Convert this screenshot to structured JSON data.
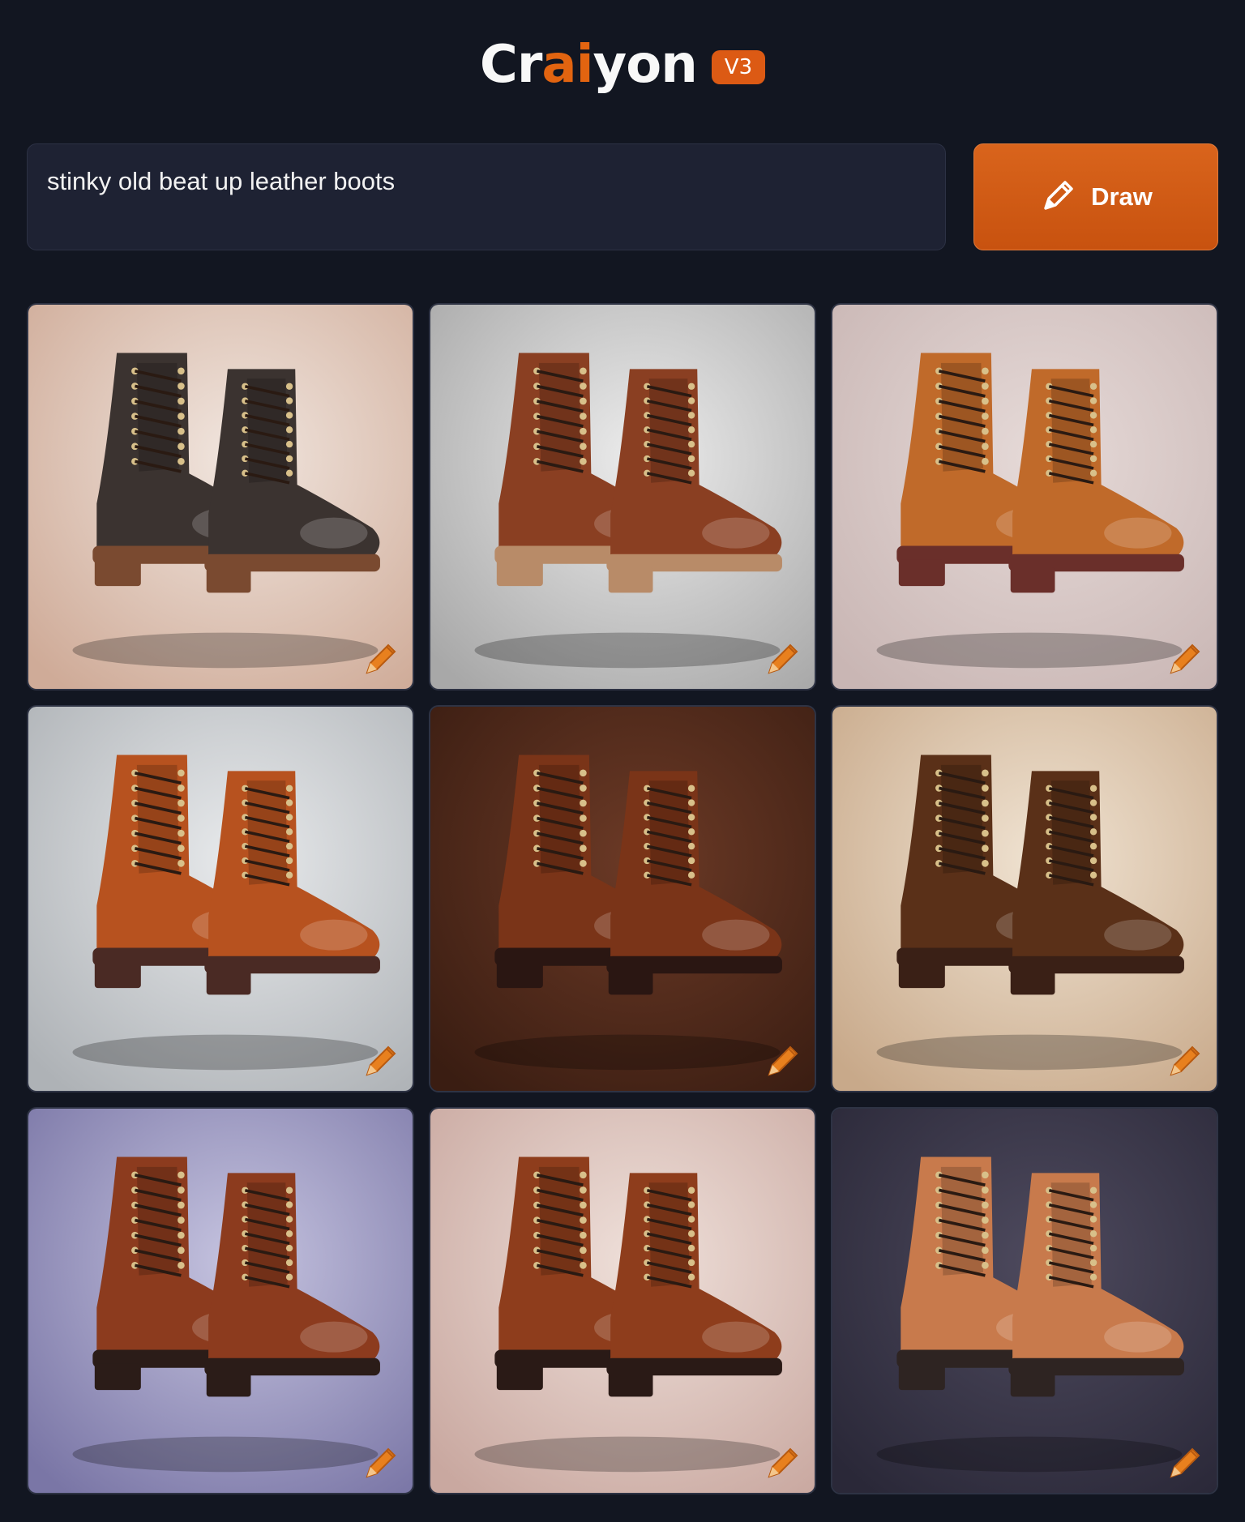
{
  "header": {
    "brand_pre": "Cr",
    "brand_ai": "ai",
    "brand_post": "yon",
    "version": "V3"
  },
  "prompt": {
    "value": "stinky old beat up leather boots"
  },
  "draw_button": {
    "label": "Draw",
    "icon": "pencil-icon"
  },
  "colors": {
    "background": "#121621",
    "accent": "#d9641c",
    "input_bg": "#1e2233"
  },
  "results": [
    {
      "bg": [
        "#cfab98",
        "#f1e6df"
      ],
      "leather": "#3b3330",
      "sole": "#7a4a30"
    },
    {
      "bg": [
        "#a8a8a8",
        "#ececec"
      ],
      "leather": "#8a3f22",
      "sole": "#b88b68"
    },
    {
      "bg": [
        "#c9b6b4",
        "#e6dad8"
      ],
      "leather": "#c06a2a",
      "sole": "#6a2f2a"
    },
    {
      "bg": [
        "#aeb2b6",
        "#e8eaec"
      ],
      "leather": "#b7521f",
      "sole": "#4a2a24"
    },
    {
      "bg": [
        "#3a1d12",
        "#6c3a26"
      ],
      "leather": "#7a3418",
      "sole": "#2a1612"
    },
    {
      "bg": [
        "#c8a98a",
        "#f0e3d2"
      ],
      "leather": "#5a3018",
      "sole": "#3a2016"
    },
    {
      "bg": [
        "#7a76a6",
        "#c6c4e0"
      ],
      "leather": "#8c3b1e",
      "sole": "#2b1c18"
    },
    {
      "bg": [
        "#c9a8a0",
        "#efe0da"
      ],
      "leather": "#8e3d1c",
      "sole": "#2a1a16"
    },
    {
      "bg": [
        "#2a2838",
        "#4e4a5e"
      ],
      "leather": "#c87a4c",
      "sole": "#2e2422"
    }
  ]
}
